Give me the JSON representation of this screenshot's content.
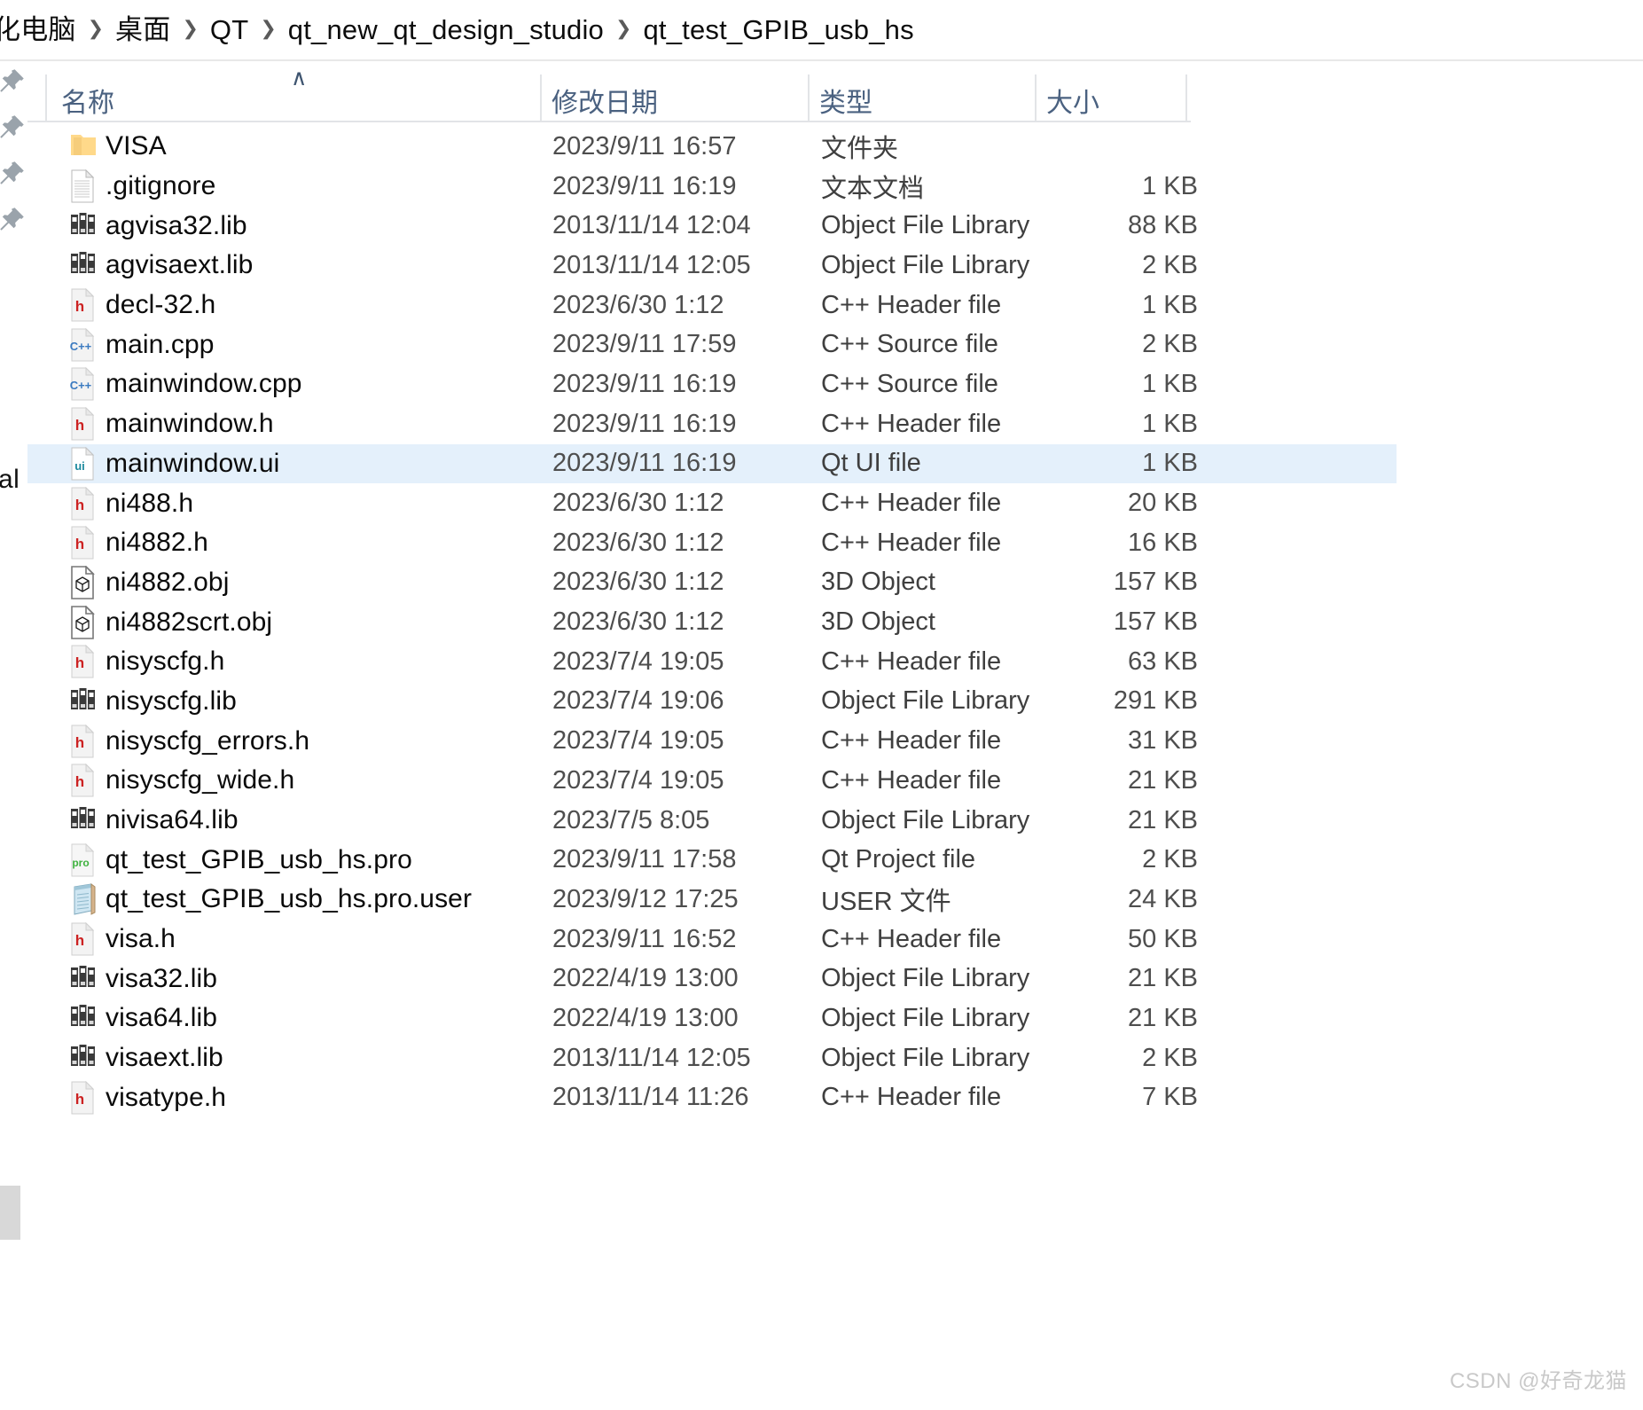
{
  "breadcrumb": {
    "separator": "❯",
    "items": [
      {
        "label": "化电脑"
      },
      {
        "label": "桌面"
      },
      {
        "label": "QT"
      },
      {
        "label": "qt_new_qt_design_studio"
      },
      {
        "label": "qt_test_GPIB_usb_hs"
      }
    ]
  },
  "nav_rail": {
    "pin_count": 4,
    "clipped_label": "al"
  },
  "columns": {
    "sort_caret": "∧",
    "name": "名称",
    "date_modified": "修改日期",
    "type": "类型",
    "size": "大小"
  },
  "colors": {
    "selection": "#e4f0fb",
    "header_text": "#4a6180",
    "folder": "#ffd98a",
    "h_glyph": "#cc2222",
    "cpp_glyph": "#3a7ac0",
    "ui_glyph": "#1d8a9e",
    "pro_glyph": "#3fb23f",
    "lib_icon": "#3a3a3a"
  },
  "files": [
    {
      "name": "VISA",
      "date": "2023/9/11 16:57",
      "type": "文件夹",
      "size": "",
      "icon": "folder-icon",
      "selected": false
    },
    {
      "name": ".gitignore",
      "date": "2023/9/11 16:19",
      "type": "文本文档",
      "size": "1 KB",
      "icon": "text-document-icon",
      "selected": false
    },
    {
      "name": "agvisa32.lib",
      "date": "2013/11/14 12:04",
      "type": "Object File Library",
      "size": "88 KB",
      "icon": "library-icon",
      "selected": false
    },
    {
      "name": "agvisaext.lib",
      "date": "2013/11/14 12:05",
      "type": "Object File Library",
      "size": "2 KB",
      "icon": "library-icon",
      "selected": false
    },
    {
      "name": "decl-32.h",
      "date": "2023/6/30 1:12",
      "type": "C++ Header file",
      "size": "1 KB",
      "icon": "h-header-icon",
      "selected": false
    },
    {
      "name": "main.cpp",
      "date": "2023/9/11 17:59",
      "type": "C++ Source file",
      "size": "2 KB",
      "icon": "cpp-source-icon",
      "selected": false
    },
    {
      "name": "mainwindow.cpp",
      "date": "2023/9/11 16:19",
      "type": "C++ Source file",
      "size": "1 KB",
      "icon": "cpp-source-icon",
      "selected": false
    },
    {
      "name": "mainwindow.h",
      "date": "2023/9/11 16:19",
      "type": "C++ Header file",
      "size": "1 KB",
      "icon": "h-header-icon",
      "selected": false
    },
    {
      "name": "mainwindow.ui",
      "date": "2023/9/11 16:19",
      "type": "Qt UI file",
      "size": "1 KB",
      "icon": "qt-ui-icon",
      "selected": true
    },
    {
      "name": "ni488.h",
      "date": "2023/6/30 1:12",
      "type": "C++ Header file",
      "size": "20 KB",
      "icon": "h-header-icon",
      "selected": false
    },
    {
      "name": "ni4882.h",
      "date": "2023/6/30 1:12",
      "type": "C++ Header file",
      "size": "16 KB",
      "icon": "h-header-icon",
      "selected": false
    },
    {
      "name": "ni4882.obj",
      "date": "2023/6/30 1:12",
      "type": "3D Object",
      "size": "157 KB",
      "icon": "obj-3d-icon",
      "selected": false
    },
    {
      "name": "ni4882scrt.obj",
      "date": "2023/6/30 1:12",
      "type": "3D Object",
      "size": "157 KB",
      "icon": "obj-3d-icon",
      "selected": false
    },
    {
      "name": "nisyscfg.h",
      "date": "2023/7/4 19:05",
      "type": "C++ Header file",
      "size": "63 KB",
      "icon": "h-header-icon",
      "selected": false
    },
    {
      "name": "nisyscfg.lib",
      "date": "2023/7/4 19:06",
      "type": "Object File Library",
      "size": "291 KB",
      "icon": "library-icon",
      "selected": false
    },
    {
      "name": "nisyscfg_errors.h",
      "date": "2023/7/4 19:05",
      "type": "C++ Header file",
      "size": "31 KB",
      "icon": "h-header-icon",
      "selected": false
    },
    {
      "name": "nisyscfg_wide.h",
      "date": "2023/7/4 19:05",
      "type": "C++ Header file",
      "size": "21 KB",
      "icon": "h-header-icon",
      "selected": false
    },
    {
      "name": "nivisa64.lib",
      "date": "2023/7/5 8:05",
      "type": "Object File Library",
      "size": "21 KB",
      "icon": "library-icon",
      "selected": false
    },
    {
      "name": "qt_test_GPIB_usb_hs.pro",
      "date": "2023/9/11 17:58",
      "type": "Qt Project file",
      "size": "2 KB",
      "icon": "pro-project-icon",
      "selected": false
    },
    {
      "name": "qt_test_GPIB_usb_hs.pro.user",
      "date": "2023/9/12 17:25",
      "type": "USER 文件",
      "size": "24 KB",
      "icon": "user-file-icon",
      "selected": false
    },
    {
      "name": "visa.h",
      "date": "2023/9/11 16:52",
      "type": "C++ Header file",
      "size": "50 KB",
      "icon": "h-header-icon",
      "selected": false
    },
    {
      "name": "visa32.lib",
      "date": "2022/4/19 13:00",
      "type": "Object File Library",
      "size": "21 KB",
      "icon": "library-icon",
      "selected": false
    },
    {
      "name": "visa64.lib",
      "date": "2022/4/19 13:00",
      "type": "Object File Library",
      "size": "21 KB",
      "icon": "library-icon",
      "selected": false
    },
    {
      "name": "visaext.lib",
      "date": "2013/11/14 12:05",
      "type": "Object File Library",
      "size": "2 KB",
      "icon": "library-icon",
      "selected": false
    },
    {
      "name": "visatype.h",
      "date": "2013/11/14 11:26",
      "type": "C++ Header file",
      "size": "7 KB",
      "icon": "h-header-icon",
      "selected": false
    }
  ],
  "watermark": "CSDN @好奇龙猫"
}
